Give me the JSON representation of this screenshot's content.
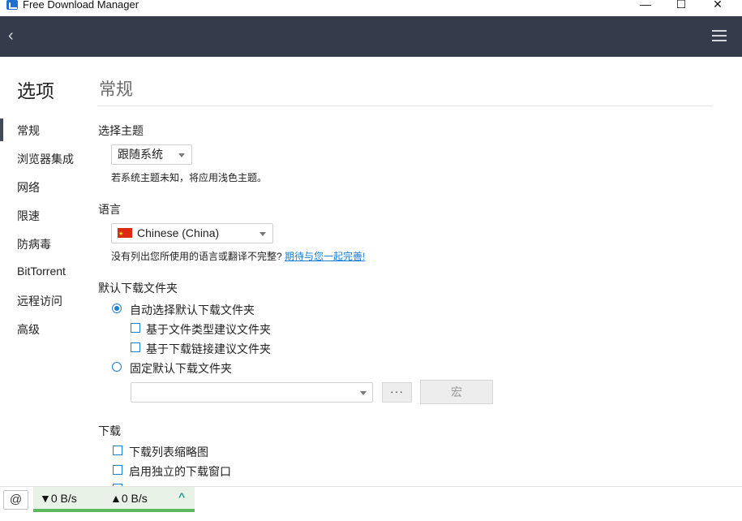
{
  "window": {
    "title": "Free Download Manager",
    "minimize_glyph": "—",
    "maximize_glyph": "☐",
    "close_glyph": "✕"
  },
  "nav": {
    "back_icon": "chevron-left-icon",
    "back_glyph": "‹",
    "menu_icon": "hamburger-menu-icon"
  },
  "sidebar": {
    "title": "选项",
    "items": [
      {
        "label": "常规",
        "active": true
      },
      {
        "label": "浏览器集成"
      },
      {
        "label": "网络"
      },
      {
        "label": "限速"
      },
      {
        "label": "防病毒"
      },
      {
        "label": "BitTorrent"
      },
      {
        "label": "远程访问"
      },
      {
        "label": "高级"
      }
    ]
  },
  "main": {
    "title": "常规",
    "theme": {
      "label": "选择主题",
      "selected": "跟随系统",
      "hint": "若系统主题未知，将应用浅色主题。"
    },
    "language": {
      "label": "语言",
      "selected": "Chinese (China)",
      "hint": "没有列出您所使用的语言或翻译不完整?",
      "link": "期待与您一起完善!"
    },
    "download_folder": {
      "label": "默认下载文件夹",
      "auto_select": "自动选择默认下载文件夹",
      "by_file_type": "基于文件类型建议文件夹",
      "by_link": "基于下载链接建议文件夹",
      "fixed": "固定默认下载文件夹",
      "path_value": "",
      "browse_label": "···",
      "macro_label": "宏"
    },
    "downloads": {
      "label": "下载",
      "thumbnails": "下载列表缩略图",
      "separate_window": "启用独立的下载窗口"
    }
  },
  "status": {
    "snail_icon": "snail-icon",
    "download_speed": "▼0 B/s",
    "upload_speed": "▲0 B/s",
    "toggle_glyph": "^",
    "accent": "#5cb85c"
  },
  "colors": {
    "navbar": "#353b4a",
    "accent": "#1a7fd6"
  }
}
